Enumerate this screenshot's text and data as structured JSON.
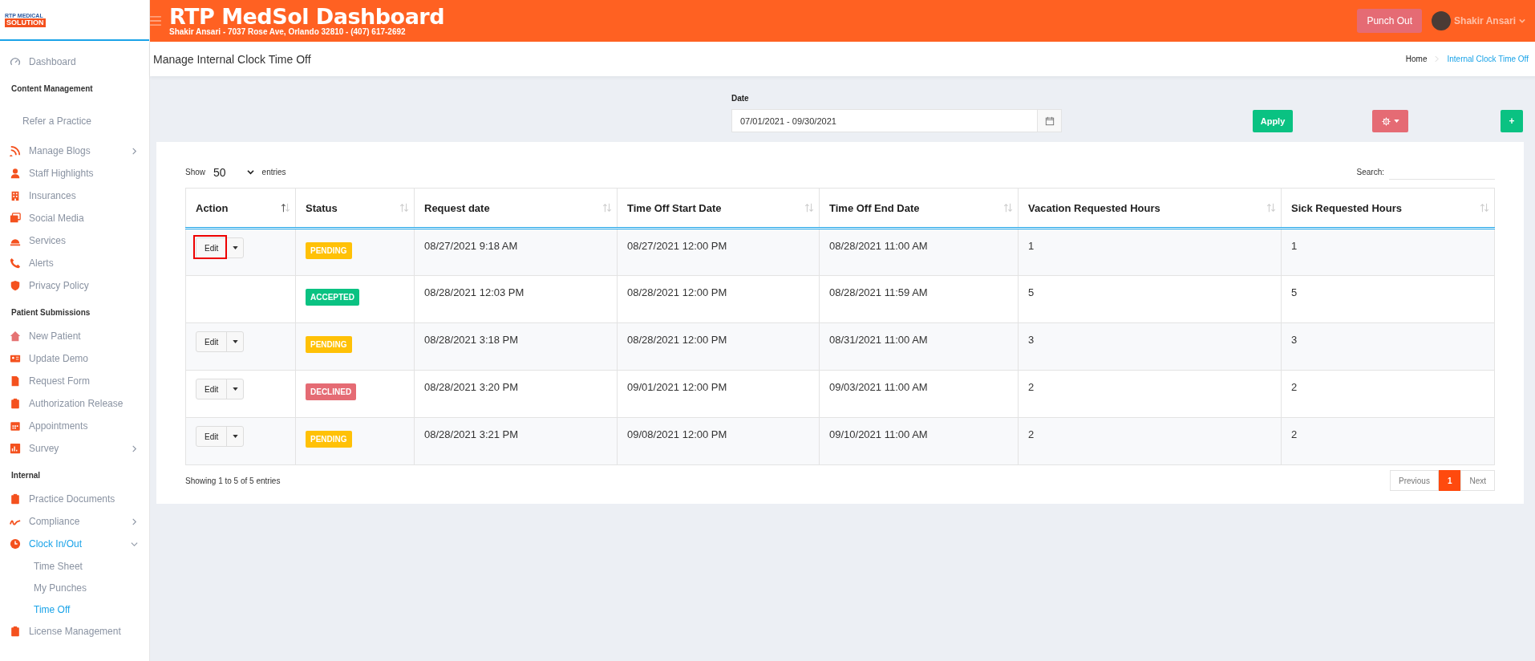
{
  "logo": {
    "line1": "RTP MEDICAL",
    "line2": "SOLUTION"
  },
  "header": {
    "title": "RTP MedSol Dashboard",
    "subtitle": "Shakir Ansari - 7037 Rose Ave, Orlando 32810 - (407) 617-2692",
    "punch_button": "Punch Out",
    "user_name": "Shakir Ansari"
  },
  "sidebar": {
    "items": [
      {
        "kind": "link",
        "label": "Dashboard",
        "selected": false,
        "expandable": false
      },
      {
        "kind": "section",
        "label": "Content Management"
      },
      {
        "kind": "plain",
        "label": "Refer a Practice",
        "selected": false
      },
      {
        "kind": "link",
        "label": "Manage Blogs",
        "selected": false,
        "expandable": true
      },
      {
        "kind": "link",
        "label": "Staff Highlights",
        "selected": false,
        "expandable": false
      },
      {
        "kind": "link",
        "label": "Insurances",
        "selected": false,
        "expandable": false
      },
      {
        "kind": "link",
        "label": "Social Media",
        "selected": false,
        "expandable": false
      },
      {
        "kind": "link",
        "label": "Services",
        "selected": false,
        "expandable": false
      },
      {
        "kind": "link",
        "label": "Alerts",
        "selected": false,
        "expandable": false
      },
      {
        "kind": "link",
        "label": "Privacy Policy",
        "selected": false,
        "expandable": false
      },
      {
        "kind": "section",
        "label": "Patient Submissions"
      },
      {
        "kind": "link",
        "label": "New Patient",
        "selected": false,
        "expandable": false
      },
      {
        "kind": "link",
        "label": "Update Demo",
        "selected": false,
        "expandable": false
      },
      {
        "kind": "link",
        "label": "Request Form",
        "selected": false,
        "expandable": false
      },
      {
        "kind": "link",
        "label": "Authorization Release",
        "selected": false,
        "expandable": false
      },
      {
        "kind": "link",
        "label": "Appointments",
        "selected": false,
        "expandable": false
      },
      {
        "kind": "link",
        "label": "Survey",
        "selected": false,
        "expandable": true
      },
      {
        "kind": "section",
        "label": "Internal"
      },
      {
        "kind": "link",
        "label": "Practice Documents",
        "selected": false,
        "expandable": false
      },
      {
        "kind": "link",
        "label": "Compliance",
        "selected": false,
        "expandable": true
      },
      {
        "kind": "link",
        "label": "Clock In/Out",
        "selected": true,
        "expandable": true,
        "expanded": true,
        "children": [
          {
            "label": "Time Sheet",
            "selected": false
          },
          {
            "label": "My Punches",
            "selected": false
          },
          {
            "label": "Time Off",
            "selected": true
          }
        ]
      },
      {
        "kind": "link",
        "label": "License Management",
        "selected": false,
        "expandable": false
      }
    ]
  },
  "page": {
    "title": "Manage Internal Clock Time Off",
    "breadcrumb": [
      {
        "label": "Home",
        "selected": false
      },
      {
        "label": "Internal Clock Time Off",
        "selected": true
      }
    ]
  },
  "filters": {
    "date_label": "Date",
    "date_value": "07/01/2021 - 09/30/2021",
    "apply_button": "Apply",
    "add_button": "+"
  },
  "table": {
    "show_label": "Show",
    "page_size": "50",
    "entries_label": "entries",
    "search_label": "Search:",
    "columns": [
      {
        "label": "Action",
        "sorted": true
      },
      {
        "label": "Status",
        "sorted": false
      },
      {
        "label": "Request date",
        "sorted": false
      },
      {
        "label": "Time Off Start Date",
        "sorted": false
      },
      {
        "label": "Time Off End Date",
        "sorted": false
      },
      {
        "label": "Vacation Requested Hours",
        "sorted": false
      },
      {
        "label": "Sick Requested Hours",
        "sorted": false
      }
    ],
    "rows": [
      {
        "edit": "Edit",
        "highlighted": true,
        "status": {
          "label": "PENDING",
          "kind": "pending"
        },
        "request_date": "08/27/2021 9:18 AM",
        "start": "08/27/2021 12:00 PM",
        "end": "08/28/2021 11:00 AM",
        "vacation": "1",
        "sick": "1"
      },
      {
        "status": {
          "label": "ACCEPTED",
          "kind": "accepted"
        },
        "request_date": "08/28/2021 12:03 PM",
        "start": "08/28/2021 12:00 PM",
        "end": "08/28/2021 11:59 AM",
        "vacation": "5",
        "sick": "5"
      },
      {
        "edit": "Edit",
        "highlighted": false,
        "status": {
          "label": "PENDING",
          "kind": "pending"
        },
        "request_date": "08/28/2021 3:18 PM",
        "start": "08/28/2021 12:00 PM",
        "end": "08/31/2021 11:00 AM",
        "vacation": "3",
        "sick": "3"
      },
      {
        "edit": "Edit",
        "highlighted": false,
        "status": {
          "label": "DECLINED",
          "kind": "declined"
        },
        "request_date": "08/28/2021 3:20 PM",
        "start": "09/01/2021 12:00 PM",
        "end": "09/03/2021 11:00 AM",
        "vacation": "2",
        "sick": "2"
      },
      {
        "edit": "Edit",
        "highlighted": false,
        "status": {
          "label": "PENDING",
          "kind": "pending"
        },
        "request_date": "08/28/2021 3:21 PM",
        "start": "09/08/2021 12:00 PM",
        "end": "09/10/2021 11:00 AM",
        "vacation": "2",
        "sick": "2"
      }
    ],
    "info": "Showing 1 to 5 of 5 entries",
    "pagination": [
      {
        "label": "Previous",
        "selected": false
      },
      {
        "label": "1",
        "selected": true
      },
      {
        "label": "Next",
        "selected": false
      }
    ]
  }
}
